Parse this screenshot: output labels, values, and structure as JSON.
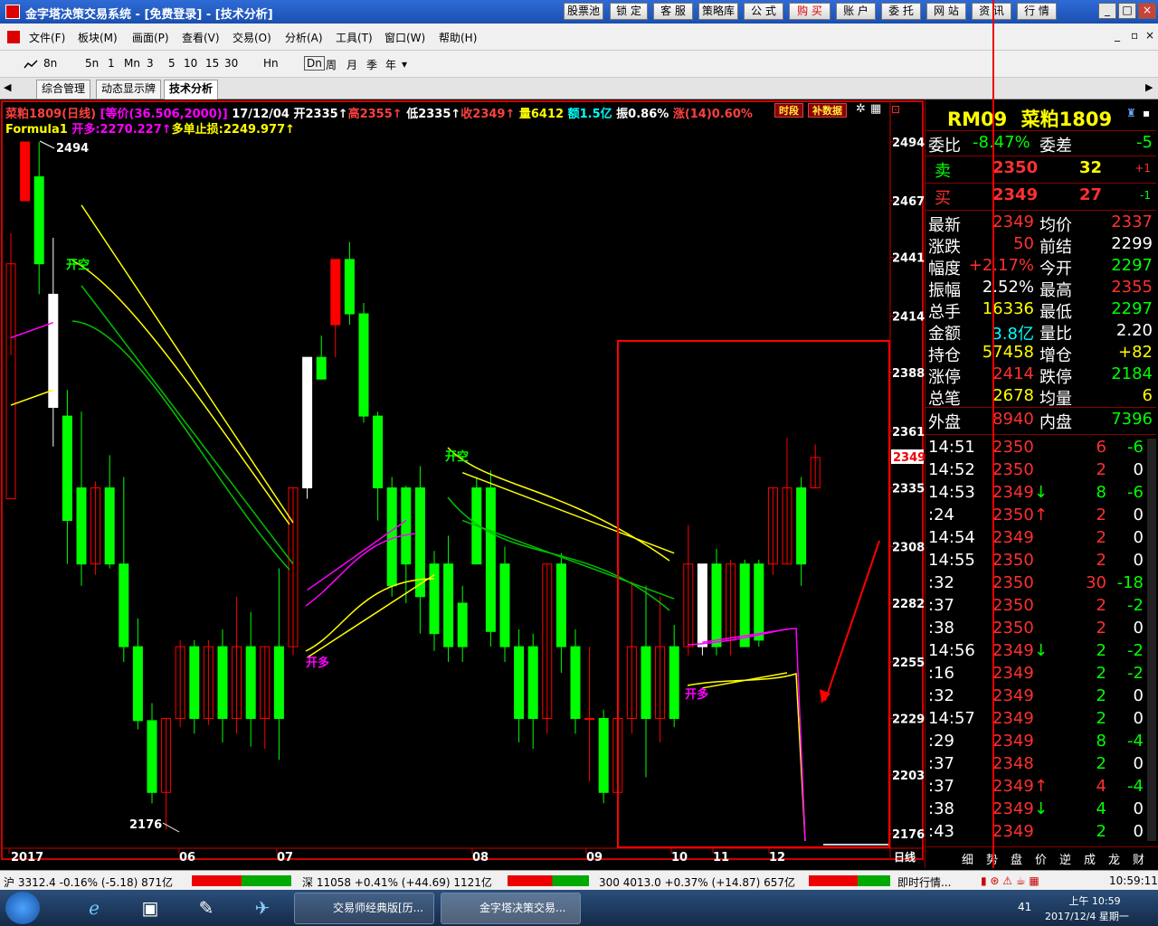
{
  "window": {
    "title": "金字塔决策交易系统 - [免费登录] - [技术分析]",
    "buttons": [
      "股票池",
      "锁 定",
      "客 服",
      "策略库",
      "公 式",
      "购 买",
      "账 户",
      "委 托",
      "网 站",
      "资 讯",
      "行 情"
    ],
    "controls": {
      "minimize": "_",
      "restore": "□",
      "close": "×"
    }
  },
  "menu": {
    "items": [
      "文件(F)",
      "板块(M)",
      "画面(P)",
      "查看(V)",
      "交易(O)",
      "分析(A)",
      "工具(T)",
      "窗口(W)",
      "帮助(H)"
    ],
    "doc_controls": {
      "minimize": "_",
      "restore": "▫",
      "close": "×"
    }
  },
  "toolbar": {
    "items": [
      "8n",
      "5n",
      "1",
      "Mn",
      "3",
      "5",
      "10",
      "15",
      "30",
      "Hn",
      "Dn",
      "周",
      "月",
      "季",
      "年"
    ]
  },
  "tabs": [
    "综合管理",
    "动态显示牌",
    "技术分析"
  ],
  "chart": {
    "info_name": "菜粕1809(日线)",
    "info_price": "[等价(36.506,2000)]",
    "info_date": "17/12/04",
    "info_open": "开2335↑",
    "info_high": "高2355↑",
    "info_low": "低2335↑",
    "info_close": "收2349↑",
    "info_vol": "量6412",
    "info_amt": "额1.5亿",
    "info_amp": "振0.86%",
    "info_chg": "涨(14)0.60%",
    "formula_name": "Formula1",
    "formula_long": "开多:2270.227↑",
    "formula_stop": "多单止损:2249.977↑",
    "btn_period": "时段",
    "btn_fill": "补数据",
    "label_high": "2494",
    "label_low": "2176",
    "sig_short1": "开空",
    "sig_short2": "开空",
    "sig_long1": "开多",
    "sig_long2": "开多",
    "current_price": "2349",
    "period_label": "日线"
  },
  "chart_data": {
    "type": "candlestick",
    "y_ticks": [
      2494,
      2467,
      2441,
      2414,
      2388,
      2361,
      2335,
      2308,
      2282,
      2255,
      2229,
      2203,
      2176
    ],
    "ylim": [
      2176,
      2494
    ],
    "x_ticks": [
      "2017",
      "06",
      "07",
      "08",
      "09",
      "10",
      "11",
      "12"
    ],
    "candles": [
      {
        "o": 2330,
        "h": 2452,
        "l": 2396,
        "c": 2438
      },
      {
        "o": 2467,
        "h": 2494,
        "l": 2467,
        "c": 2494
      },
      {
        "o": 2478,
        "h": 2494,
        "l": 2424,
        "c": 2438
      },
      {
        "o": 2424,
        "h": 2450,
        "l": 2354,
        "c": 2372
      },
      {
        "o": 2368,
        "h": 2380,
        "l": 2300,
        "c": 2320
      },
      {
        "o": 2335,
        "h": 2370,
        "l": 2290,
        "c": 2300
      },
      {
        "o": 2300,
        "h": 2338,
        "l": 2295,
        "c": 2335
      },
      {
        "o": 2335,
        "h": 2350,
        "l": 2298,
        "c": 2300
      },
      {
        "o": 2300,
        "h": 2340,
        "l": 2255,
        "c": 2262
      },
      {
        "o": 2262,
        "h": 2275,
        "l": 2224,
        "c": 2228
      },
      {
        "o": 2228,
        "h": 2236,
        "l": 2190,
        "c": 2195
      },
      {
        "o": 2195,
        "h": 2229,
        "l": 2178,
        "c": 2229
      },
      {
        "o": 2229,
        "h": 2265,
        "l": 2225,
        "c": 2262
      },
      {
        "o": 2262,
        "h": 2265,
        "l": 2222,
        "c": 2229
      },
      {
        "o": 2229,
        "h": 2265,
        "l": 2226,
        "c": 2262
      },
      {
        "o": 2262,
        "h": 2270,
        "l": 2218,
        "c": 2229
      },
      {
        "o": 2229,
        "h": 2285,
        "l": 2222,
        "c": 2262
      },
      {
        "o": 2262,
        "h": 2278,
        "l": 2216,
        "c": 2229
      },
      {
        "o": 2229,
        "h": 2262,
        "l": 2215,
        "c": 2262
      },
      {
        "o": 2262,
        "h": 2298,
        "l": 2210,
        "c": 2229
      },
      {
        "o": 2262,
        "h": 2335,
        "l": 2258,
        "c": 2335
      },
      {
        "o": 2335,
        "h": 2395,
        "l": 2330,
        "c": 2395
      },
      {
        "o": 2395,
        "h": 2405,
        "l": 2385,
        "c": 2385
      },
      {
        "o": 2410,
        "h": 2440,
        "l": 2395,
        "c": 2440
      },
      {
        "o": 2440,
        "h": 2448,
        "l": 2410,
        "c": 2415
      },
      {
        "o": 2415,
        "h": 2420,
        "l": 2365,
        "c": 2368
      },
      {
        "o": 2368,
        "h": 2370,
        "l": 2320,
        "c": 2335
      },
      {
        "o": 2335,
        "h": 2340,
        "l": 2285,
        "c": 2290
      },
      {
        "o": 2335,
        "h": 2336,
        "l": 2282,
        "c": 2300
      },
      {
        "o": 2335,
        "h": 2345,
        "l": 2268,
        "c": 2285
      },
      {
        "o": 2300,
        "h": 2306,
        "l": 2260,
        "c": 2268
      },
      {
        "o": 2300,
        "h": 2313,
        "l": 2255,
        "c": 2262
      },
      {
        "o": 2282,
        "h": 2290,
        "l": 2255,
        "c": 2262
      },
      {
        "o": 2335,
        "h": 2340,
        "l": 2300,
        "c": 2300
      },
      {
        "o": 2335,
        "h": 2343,
        "l": 2262,
        "c": 2269
      },
      {
        "o": 2300,
        "h": 2308,
        "l": 2255,
        "c": 2262
      },
      {
        "o": 2262,
        "h": 2270,
        "l": 2218,
        "c": 2229
      },
      {
        "o": 2262,
        "h": 2268,
        "l": 2215,
        "c": 2229
      },
      {
        "o": 2229,
        "h": 2300,
        "l": 2222,
        "c": 2300
      },
      {
        "o": 2300,
        "h": 2305,
        "l": 2250,
        "c": 2262
      },
      {
        "o": 2262,
        "h": 2270,
        "l": 2222,
        "c": 2229
      },
      {
        "o": 2229,
        "h": 2262,
        "l": 2200,
        "c": 2229
      },
      {
        "o": 2229,
        "h": 2233,
        "l": 2190,
        "c": 2195
      },
      {
        "o": 2195,
        "h": 2231,
        "l": 2190,
        "c": 2229
      },
      {
        "o": 2229,
        "h": 2292,
        "l": 2222,
        "c": 2262
      },
      {
        "o": 2262,
        "h": 2290,
        "l": 2202,
        "c": 2229
      },
      {
        "o": 2229,
        "h": 2285,
        "l": 2218,
        "c": 2262
      },
      {
        "o": 2262,
        "h": 2272,
        "l": 2225,
        "c": 2229
      },
      {
        "o": 2262,
        "h": 2318,
        "l": 2258,
        "c": 2300
      },
      {
        "o": 2262,
        "h": 2300,
        "l": 2258,
        "c": 2300
      },
      {
        "o": 2300,
        "h": 2307,
        "l": 2258,
        "c": 2262
      },
      {
        "o": 2265,
        "h": 2302,
        "l": 2258,
        "c": 2300
      },
      {
        "o": 2300,
        "h": 2302,
        "l": 2262,
        "c": 2262
      },
      {
        "o": 2300,
        "h": 2302,
        "l": 2262,
        "c": 2265
      },
      {
        "o": 2300,
        "h": 2335,
        "l": 2295,
        "c": 2335
      },
      {
        "o": 2300,
        "h": 2358,
        "l": 2300,
        "c": 2335
      },
      {
        "o": 2335,
        "h": 2340,
        "l": 2290,
        "c": 2300
      },
      {
        "o": 2335,
        "h": 2355,
        "l": 2335,
        "c": 2349
      }
    ],
    "series": [
      {
        "name": "多单止损",
        "color": "#ffff00",
        "values_note": "yellow stop line",
        "segments": [
          [
            [
              0,
              2373
            ],
            [
              3,
              2380
            ]
          ],
          [
            [
              5,
              2465
            ],
            [
              20,
              2319
            ]
          ],
          [
            [
              21,
              2257
            ],
            [
              30,
              2295
            ]
          ],
          [
            [
              32,
              2342
            ],
            [
              47,
              2305
            ]
          ],
          [
            [
              49,
              2243
            ],
            [
              55,
              2250
            ]
          ]
        ]
      },
      {
        "name": "开多",
        "color": "#ff00ff",
        "segments": [
          [
            [
              0,
              2404
            ],
            [
              3,
              2411
            ]
          ],
          [
            [
              21,
              2288
            ],
            [
              28,
              2320
            ]
          ],
          [
            [
              49,
              2264
            ],
            [
              55,
              2270
            ]
          ]
        ]
      },
      {
        "name": "green",
        "color": "#00c000",
        "segments": [
          [
            [
              5,
              2428
            ],
            [
              20,
              2300
            ]
          ],
          [
            [
              32,
              2320
            ],
            [
              47,
              2284
            ]
          ]
        ]
      }
    ]
  },
  "quote": {
    "code": "RM09",
    "name": "菜粕1809",
    "wb_label": "委比",
    "wb_value": "-8.47%",
    "wc_label": "委差",
    "wc_value": "-5",
    "sell_label": "卖",
    "sell_price": "2350",
    "sell_vol": "32",
    "sell_chg": "+1",
    "buy_label": "买",
    "buy_price": "2349",
    "buy_vol": "27",
    "buy_chg": "-1",
    "stats": [
      {
        "l1": "最新",
        "v1": "2349",
        "c1": "#ff3030",
        "l2": "均价",
        "v2": "2337",
        "c2": "#ff3030"
      },
      {
        "l1": "涨跌",
        "v1": "50",
        "c1": "#ff3030",
        "l2": "前结",
        "v2": "2299",
        "c2": "#ffffff"
      },
      {
        "l1": "幅度",
        "v1": "+2.17%",
        "c1": "#ff3030",
        "l2": "今开",
        "v2": "2297",
        "c2": "#00ff00"
      },
      {
        "l1": "振幅",
        "v1": "2.52%",
        "c1": "#ffffff",
        "l2": "最高",
        "v2": "2355",
        "c2": "#ff3030"
      },
      {
        "l1": "总手",
        "v1": "16336",
        "c1": "#ffff00",
        "l2": "最低",
        "v2": "2297",
        "c2": "#00ff00"
      },
      {
        "l1": "金额",
        "v1": "3.8亿",
        "c1": "#00ffff",
        "l2": "量比",
        "v2": "2.20",
        "c2": "#ffffff"
      },
      {
        "l1": "持仓",
        "v1": "57458",
        "c1": "#ffff00",
        "l2": "增仓",
        "v2": "+82",
        "c2": "#ffff00"
      },
      {
        "l1": "涨停",
        "v1": "2414",
        "c1": "#ff3030",
        "l2": "跌停",
        "v2": "2184",
        "c2": "#00ff00"
      },
      {
        "l1": "总笔",
        "v1": "2678",
        "c1": "#ffff00",
        "l2": "均量",
        "v2": "6",
        "c2": "#ffff00"
      }
    ],
    "outer_label": "外盘",
    "outer_value": "8940",
    "inner_label": "内盘",
    "inner_value": "7396",
    "ticks": [
      {
        "t": "14:51",
        "p": "2350",
        "a": "",
        "v": "6",
        "d": "-6",
        "pc": "#ff3030",
        "vc": "#ff3030",
        "dc": "#00ff00"
      },
      {
        "t": "14:52",
        "p": "2350",
        "a": "",
        "v": "2",
        "d": "0",
        "pc": "#ff3030",
        "vc": "#ff3030",
        "dc": "#ffffff"
      },
      {
        "t": "14:53",
        "p": "2349",
        "a": "↓",
        "v": "8",
        "d": "-6",
        "pc": "#ff3030",
        "vc": "#00ff00",
        "dc": "#00ff00"
      },
      {
        "t": ":24",
        "p": "2350",
        "a": "↑",
        "v": "2",
        "d": "0",
        "pc": "#ff3030",
        "vc": "#ff3030",
        "dc": "#ffffff"
      },
      {
        "t": "14:54",
        "p": "2349",
        "a": "",
        "v": "2",
        "d": "0",
        "pc": "#ff3030",
        "vc": "#ff3030",
        "dc": "#ffffff"
      },
      {
        "t": "14:55",
        "p": "2350",
        "a": "",
        "v": "2",
        "d": "0",
        "pc": "#ff3030",
        "vc": "#ff3030",
        "dc": "#ffffff"
      },
      {
        "t": ":32",
        "p": "2350",
        "a": "",
        "v": "30",
        "d": "-18",
        "pc": "#ff3030",
        "vc": "#ff3030",
        "dc": "#00ff00"
      },
      {
        "t": ":37",
        "p": "2350",
        "a": "",
        "v": "2",
        "d": "-2",
        "pc": "#ff3030",
        "vc": "#ff3030",
        "dc": "#00ff00"
      },
      {
        "t": ":38",
        "p": "2350",
        "a": "",
        "v": "2",
        "d": "0",
        "pc": "#ff3030",
        "vc": "#ff3030",
        "dc": "#ffffff"
      },
      {
        "t": "14:56",
        "p": "2349",
        "a": "↓",
        "v": "2",
        "d": "-2",
        "pc": "#ff3030",
        "vc": "#00ff00",
        "dc": "#00ff00"
      },
      {
        "t": ":16",
        "p": "2349",
        "a": "",
        "v": "2",
        "d": "-2",
        "pc": "#ff3030",
        "vc": "#00ff00",
        "dc": "#00ff00"
      },
      {
        "t": ":32",
        "p": "2349",
        "a": "",
        "v": "2",
        "d": "0",
        "pc": "#ff3030",
        "vc": "#00ff00",
        "dc": "#ffffff"
      },
      {
        "t": "14:57",
        "p": "2349",
        "a": "",
        "v": "2",
        "d": "0",
        "pc": "#ff3030",
        "vc": "#00ff00",
        "dc": "#ffffff"
      },
      {
        "t": ":29",
        "p": "2349",
        "a": "",
        "v": "8",
        "d": "-4",
        "pc": "#ff3030",
        "vc": "#00ff00",
        "dc": "#00ff00"
      },
      {
        "t": ":37",
        "p": "2348",
        "a": "",
        "v": "2",
        "d": "0",
        "pc": "#ff3030",
        "vc": "#00ff00",
        "dc": "#ffffff"
      },
      {
        "t": ":37",
        "p": "2349",
        "a": "↑",
        "v": "4",
        "d": "-4",
        "pc": "#ff3030",
        "vc": "#ff3030",
        "dc": "#00ff00"
      },
      {
        "t": ":38",
        "p": "2349",
        "a": "↓",
        "v": "4",
        "d": "0",
        "pc": "#ff3030",
        "vc": "#00ff00",
        "dc": "#ffffff"
      },
      {
        "t": ":43",
        "p": "2349",
        "a": "",
        "v": "2",
        "d": "0",
        "pc": "#ff3030",
        "vc": "#00ff00",
        "dc": "#ffffff"
      }
    ],
    "bottom_tabs": [
      "细",
      "势",
      "盘",
      "价",
      "逆",
      "成",
      "龙",
      "财"
    ]
  },
  "status": {
    "sh": "沪 3312.4 -0.16% (-5.18) 871亿",
    "sz": "深 11058 +0.41% (+44.69) 1121亿",
    "i300": "300 4013.0 +0.37% (+14.87) 657亿",
    "instant": "即时行情...",
    "time": "10:59:11"
  },
  "taskbar": {
    "task1": "交易师经典版[历...",
    "task2": "金字塔决策交易...",
    "clock_time": "上午 10:59",
    "clock_date": "2017/12/4 星期一",
    "tray_num": "41"
  },
  "colors": {
    "up": "#ff0000",
    "down": "#00ff00",
    "highlight_box": "#ff0000",
    "yellow": "#ffff00",
    "magenta": "#ff00ff"
  }
}
